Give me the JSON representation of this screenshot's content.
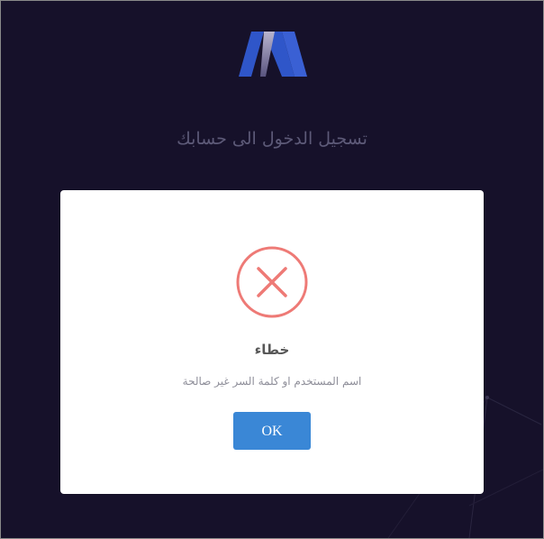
{
  "login": {
    "title": "تسجيل الدخول الى حسابك"
  },
  "logo": {
    "icon": "brand-m-logo",
    "colors": {
      "blue": "#2f56c9",
      "light": "#d7d4e6"
    }
  },
  "dialog": {
    "icon": "error-x-icon",
    "icon_color": "#ee7a76",
    "title": "خطاء",
    "message": "اسم المستخدم او كلمة السر غير صالحة",
    "ok_label": "OK",
    "button_color": "#3a87d6"
  },
  "theme": {
    "background": "#16112a"
  }
}
